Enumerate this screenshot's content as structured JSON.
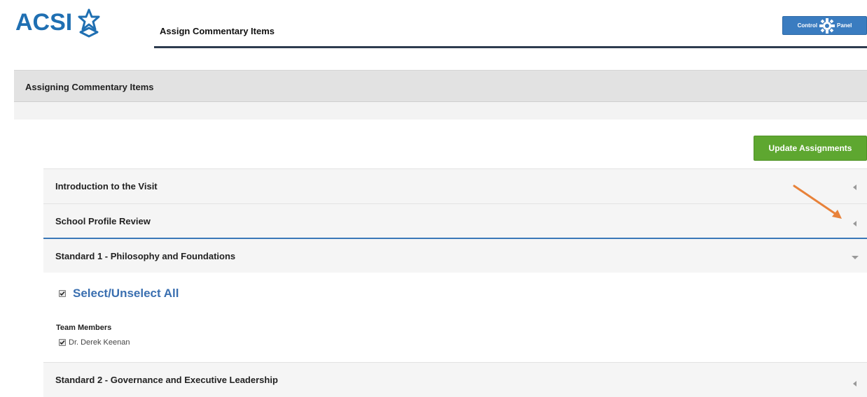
{
  "header": {
    "logo_text": "ACSI",
    "title": "Assign Commentary Items",
    "control_panel": {
      "left_label": "Control",
      "right_label": "Panel",
      "icon": "gear-icon"
    }
  },
  "panel": {
    "heading": "Assigning Commentary Items"
  },
  "actions": {
    "update_label": "Update Assignments"
  },
  "sections": [
    {
      "label": "Introduction to the Visit",
      "expanded": false
    },
    {
      "label": "School Profile Review",
      "expanded": false
    },
    {
      "label": "Standard 1 - Philosophy and Foundations",
      "expanded": true
    },
    {
      "label": "Standard 2 - Governance and Executive Leadership",
      "expanded": false
    }
  ],
  "expanded_section": {
    "select_all_label": "Select/Unselect All",
    "select_all_checked": true,
    "team_members_heading": "Team Members",
    "members": [
      {
        "name": "Dr. Derek Keenan",
        "checked": true
      }
    ]
  },
  "colors": {
    "brand_blue": "#1f6fb2",
    "control_button": "#3a7cc0",
    "update_button": "#5ea730",
    "annotation_arrow": "#e8823a",
    "select_all_text": "#3a6fb0"
  }
}
